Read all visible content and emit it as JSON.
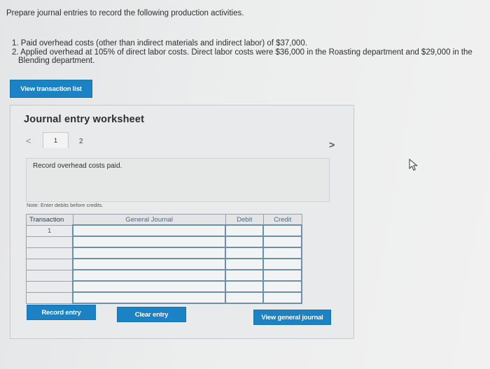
{
  "instructions": "Prepare journal entries to record the following production activities.",
  "activities": [
    "1. Paid overhead costs (other than indirect materials and indirect labor) of $37,000.",
    "2. Applied overhead at 105% of direct labor costs. Direct labor costs were $36,000 in the Roasting department and $29,000 in the",
    "Blending department."
  ],
  "buttons": {
    "view_transaction_list": "View transaction list",
    "record_entry": "Record entry",
    "clear_entry": "Clear entry",
    "view_general_journal": "View general journal"
  },
  "worksheet": {
    "title": "Journal entry worksheet",
    "tabs": [
      "1",
      "2"
    ],
    "prev_icon": "chevron-left-icon",
    "next_icon": "chevron-right-icon",
    "prev_glyph": "<",
    "next_glyph": ">",
    "description": "Record overhead costs paid.",
    "note": "Note: Enter debits before credits."
  },
  "journal_table": {
    "headers": [
      "Transaction",
      "General Journal",
      "Debit",
      "Credit"
    ],
    "transaction_number": "1",
    "row_count": 7
  },
  "colors": {
    "button_blue": "#1a82c5",
    "input_border": "#6c8fb0"
  }
}
